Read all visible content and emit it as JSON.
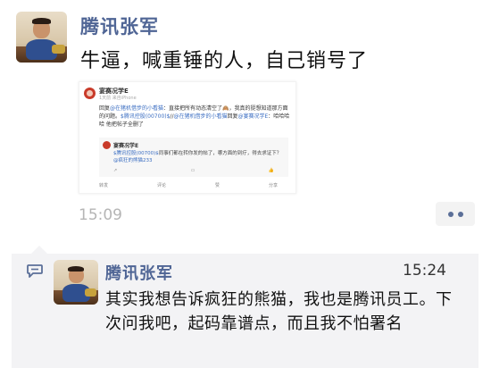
{
  "post": {
    "author": "腾讯张军",
    "text": "牛逼，喊重锤的人，自己销号了",
    "time": "15:09",
    "more_icon": "more-dots-icon"
  },
  "screenshot": {
    "author": "宴赛况学E",
    "meta": "1天前 来自iPhone",
    "text_a": "回复",
    "mention_a": "@在猪机借步的小看猫",
    "text_b": "：直接把所有动态清空了🙈，我真的挺想知道那方面的问题。",
    "mention_b": "$腾讯控股(00700)$",
    "text_c": "//",
    "mention_c": "@在猪机借步的小看猫",
    "text_d": "回复",
    "mention_d": "@宴赛况学E",
    "text_e": "：哈哈哈哈 他把帖子全删了",
    "quote": {
      "author": "宴赛况学E",
      "mention_a": "$腾讯控股(00700)$",
      "text_a": "同事们都在转你发的帖了，哪方面的到疗，得去求证下？",
      "mention_b": "@疯狂的熊猫233"
    },
    "actions": [
      "转发",
      "评论",
      "赞",
      "分享"
    ]
  },
  "comment": {
    "author": "腾讯张军",
    "time": "15:24",
    "text": "其实我想告诉疯狂的熊猫，我也是腾讯员工。下次问我吧，起码靠谱点，而且我不怕署名",
    "icon": "comment-bubble-icon"
  },
  "colors": {
    "name_blue": "#4f6595",
    "comment_bg": "#f3f3f5",
    "time_gray": "#b5b5b5"
  }
}
